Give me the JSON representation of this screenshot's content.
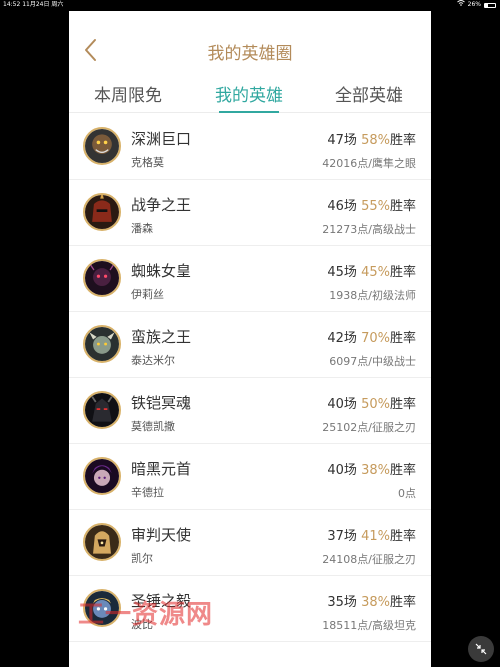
{
  "status_bar": {
    "time": "14:52",
    "date": "11月24日 周六",
    "battery": "26%"
  },
  "nav": {
    "title": "我的英雄圈",
    "back_icon": "chevron-left-icon"
  },
  "tabs": [
    {
      "label": "本周限免",
      "active": false
    },
    {
      "label": "我的英雄",
      "active": true
    },
    {
      "label": "全部英雄",
      "active": false
    }
  ],
  "heroes": [
    {
      "name": "深渊巨口",
      "title": "克格莫",
      "games": "47场",
      "rate": "58%",
      "rate_suffix": "胜率",
      "points": "42016点/鹰隼之眼",
      "avatar_color": "#7a5a3a"
    },
    {
      "name": "战争之王",
      "title": "潘森",
      "games": "46场",
      "rate": "55%",
      "rate_suffix": "胜率",
      "points": "21273点/高级战士",
      "avatar_color": "#8a2a1a"
    },
    {
      "name": "蜘蛛女皇",
      "title": "伊莉丝",
      "games": "45场",
      "rate": "45%",
      "rate_suffix": "胜率",
      "points": "1938点/初级法师",
      "avatar_color": "#4a2040"
    },
    {
      "name": "蛮族之王",
      "title": "泰达米尔",
      "games": "42场",
      "rate": "70%",
      "rate_suffix": "胜率",
      "points": "6097点/中级战士",
      "avatar_color": "#6a7a6a"
    },
    {
      "name": "铁铠冥魂",
      "title": "莫德凯撒",
      "games": "40场",
      "rate": "50%",
      "rate_suffix": "胜率",
      "points": "25102点/征服之刃",
      "avatar_color": "#2a2a30"
    },
    {
      "name": "暗黑元首",
      "title": "辛德拉",
      "games": "40场",
      "rate": "38%",
      "rate_suffix": "胜率",
      "points": "0点",
      "avatar_color": "#5a2a6a"
    },
    {
      "name": "审判天使",
      "title": "凯尔",
      "games": "37场",
      "rate": "41%",
      "rate_suffix": "胜率",
      "points": "24108点/征服之刃",
      "avatar_color": "#b08a50"
    },
    {
      "name": "圣锤之毅",
      "title": "波比",
      "games": "35场",
      "rate": "38%",
      "rate_suffix": "胜率",
      "points": "18511点/高级坦克",
      "avatar_color": "#3a5a8a"
    }
  ],
  "watermark": "工一资源网",
  "colors": {
    "accent": "#31a8a0",
    "gold": "#b38b5a",
    "rate": "#c69b5d"
  }
}
